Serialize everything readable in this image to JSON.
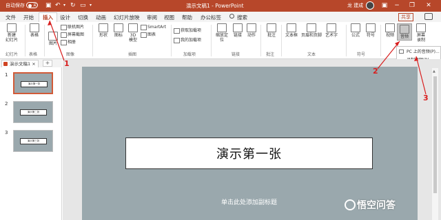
{
  "titlebar": {
    "autosave_label": "自动保存",
    "autosave_state": "关",
    "doc_title": "演示文稿1 - PowerPoint",
    "user_name": "龙 建成",
    "accent": "#b7472a"
  },
  "tabs": {
    "items": [
      "文件",
      "开始",
      "插入",
      "设计",
      "切换",
      "动画",
      "幻灯片放映",
      "审阅",
      "视图",
      "帮助",
      "办公标签"
    ],
    "active": "插入",
    "search": "搜索",
    "share": "共享"
  },
  "ribbon": {
    "new_slide": "新建\n幻灯片",
    "table": "表格",
    "image": "图片",
    "online_pic": "联机图片",
    "screenshot": "屏幕截图",
    "album": "相册",
    "shapes": "形状",
    "icons": "图标",
    "model3d": "3D\n模型",
    "smartart": "SmartArt",
    "chart": "图表",
    "get_addins": "获取加载项",
    "my_addins": "我的加载项",
    "zoom": "缩放定\n位",
    "link": "链接",
    "action": "动作",
    "comment": "批注",
    "textbox": "文本框",
    "header_footer": "页眉和页脚",
    "wordart": "艺术字",
    "formula": "公式",
    "symbol": "符号",
    "video": "视频",
    "audio": "音频",
    "screen_record": "屏幕\n录制",
    "groups": {
      "slides": "幻灯片",
      "tables": "表格",
      "images": "图像",
      "illustrations": "插图",
      "addins": "加载项",
      "links": "链接",
      "comments": "批注",
      "text": "文本",
      "symbols": "符号"
    }
  },
  "audio_menu": {
    "item1": "PC 上的音频(P)...",
    "item2": "录制音频(R)..."
  },
  "filetab": {
    "name": "演示文稿1",
    "close": "×",
    "add": "+"
  },
  "slides_pane": {
    "items": [
      {
        "num": "1",
        "text": "演示第一张"
      },
      {
        "num": "2",
        "text": "演示第二张"
      },
      {
        "num": "3",
        "text": "演示第三张"
      }
    ]
  },
  "slide": {
    "title": "演示第一张",
    "subtitle": "单击此处添加副标题"
  },
  "annotations": [
    "1",
    "2",
    "3"
  ],
  "watermark": "悟空问答"
}
